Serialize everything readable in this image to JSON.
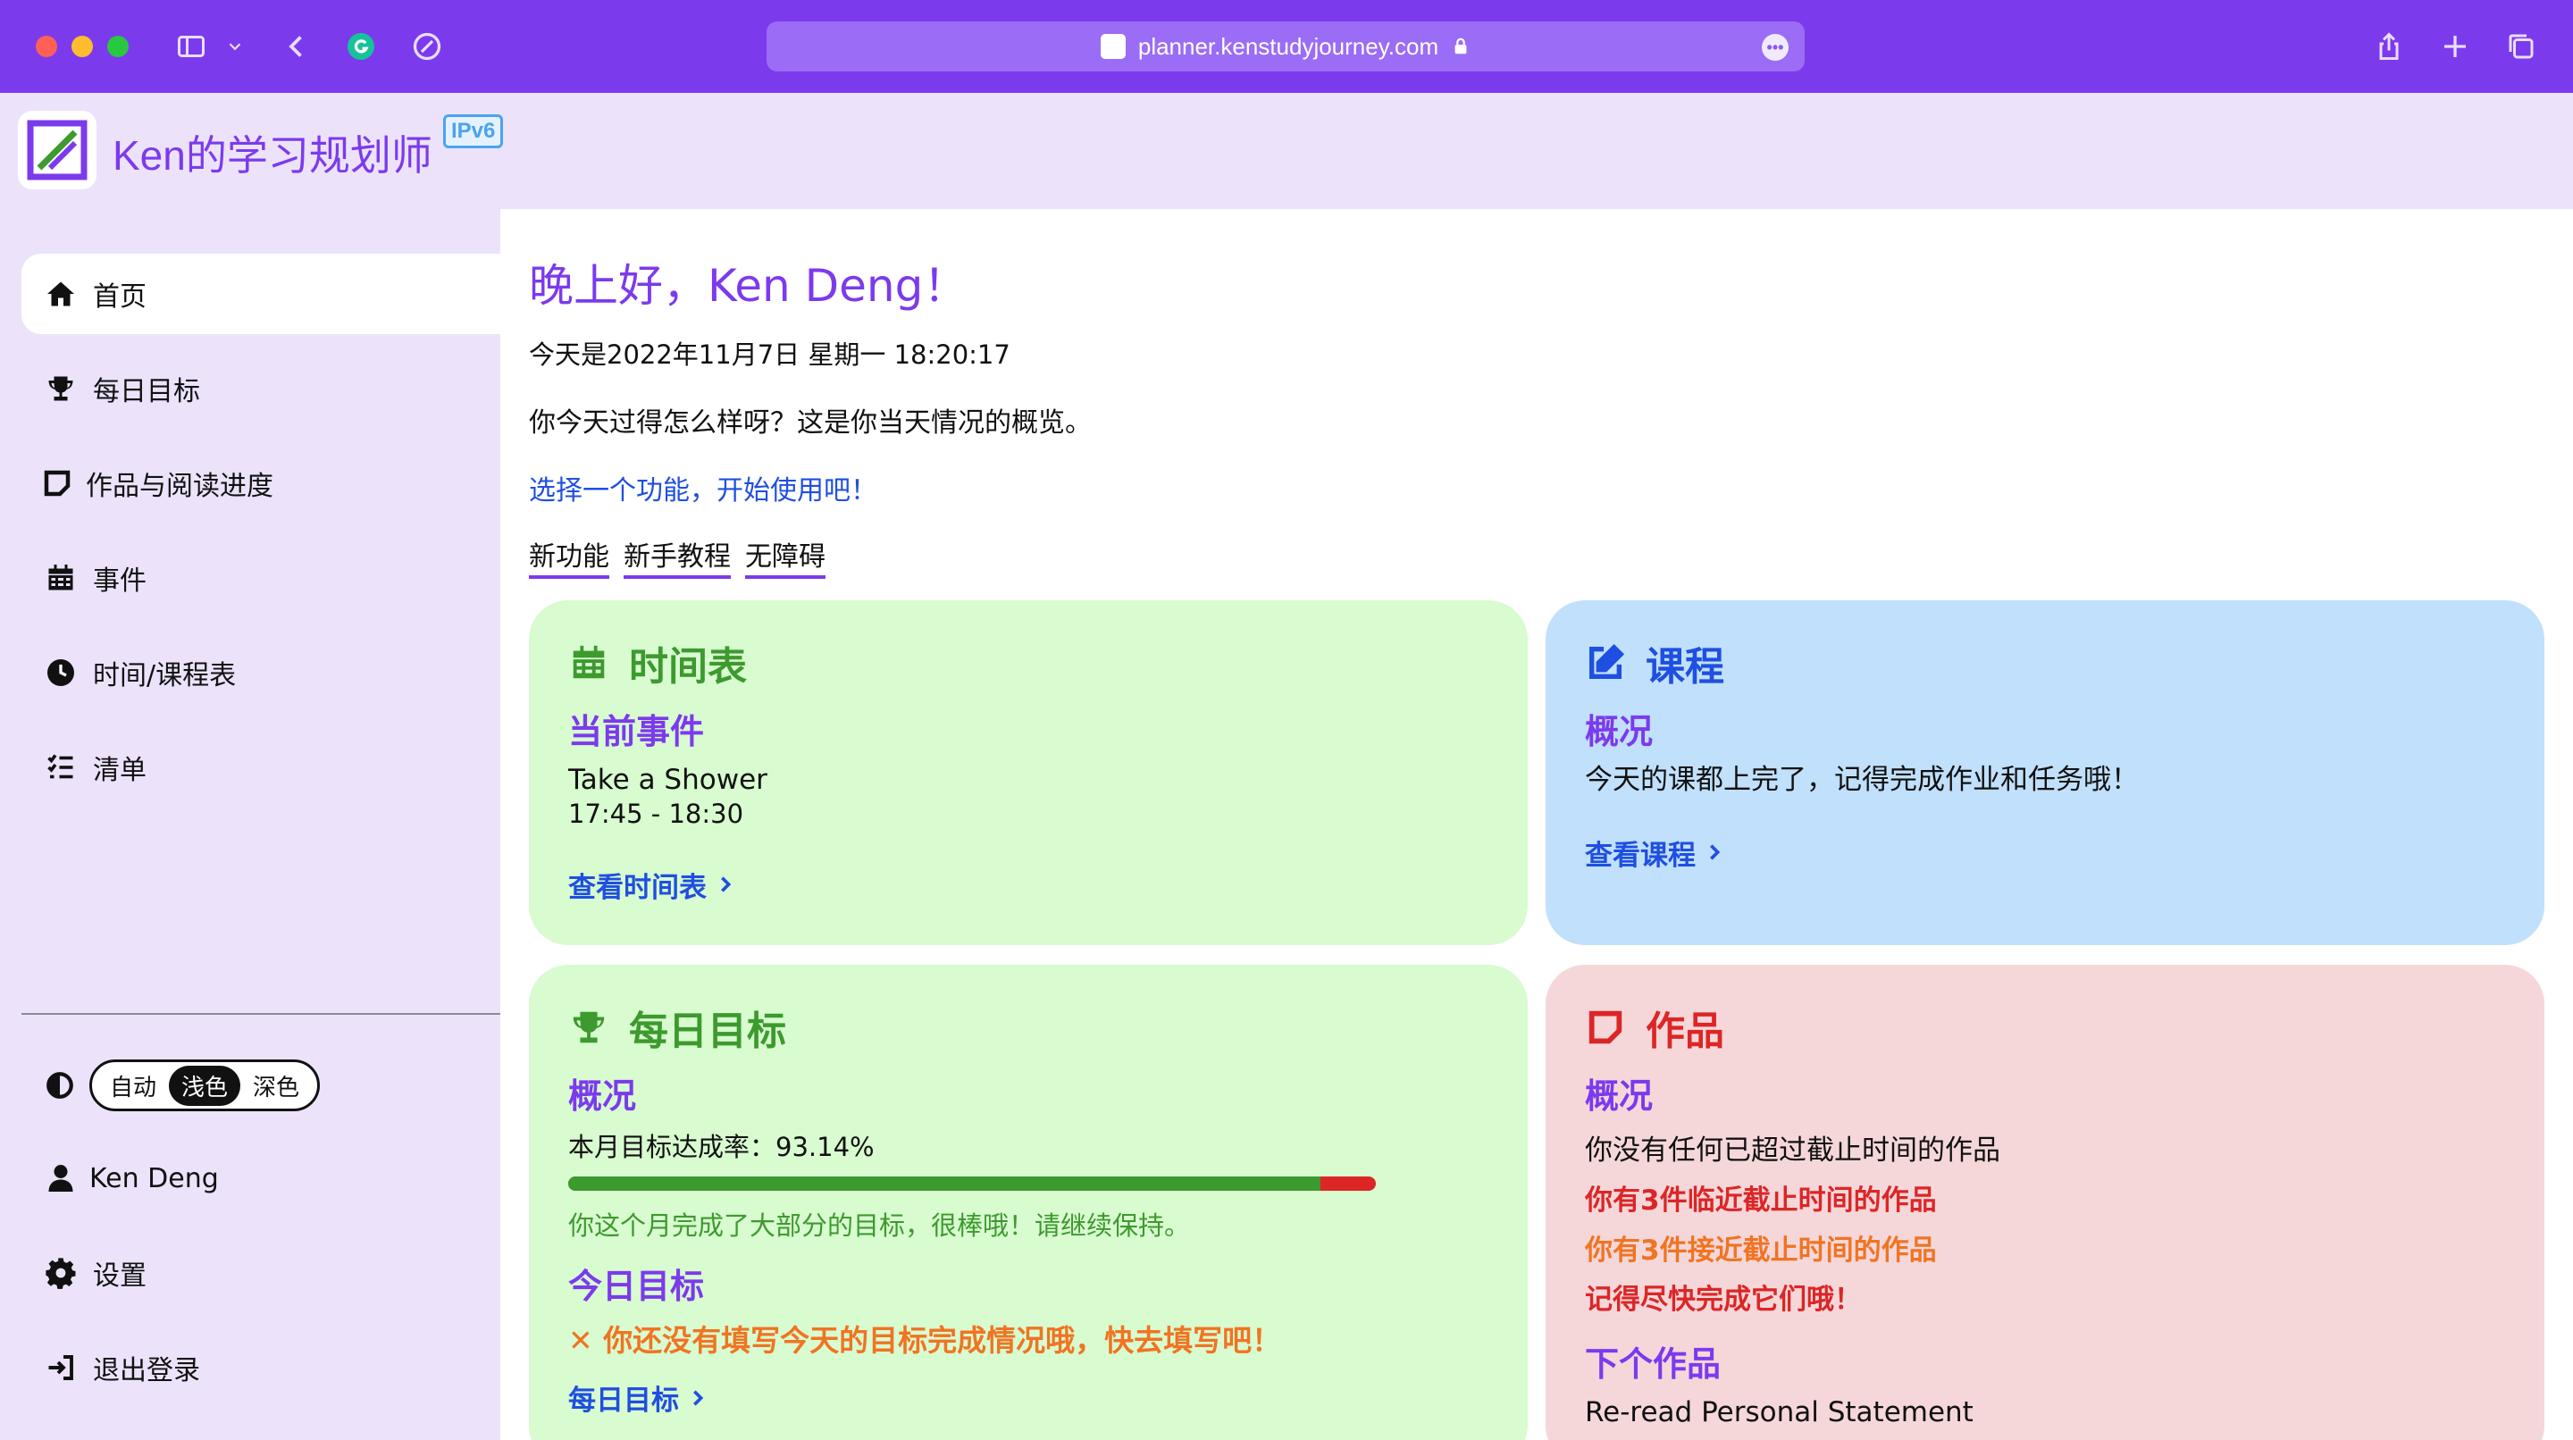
{
  "browser": {
    "url": "planner.kenstudyjourney.com",
    "icons": [
      "sidebar-toggle-icon",
      "chevron-down-icon",
      "back-icon",
      "grammarly-icon",
      "extension-icon",
      "share-icon",
      "new-tab-icon",
      "tab-overview-icon"
    ],
    "colors": {
      "chrome": "#7c3aed",
      "address_bar": "#9b6cf5"
    }
  },
  "app": {
    "name": "Ken的学习规划师",
    "badge": "IPv6",
    "accent": "#7c3aed"
  },
  "sidebar": {
    "items": [
      {
        "label": "首页",
        "icon": "home-icon",
        "active": true
      },
      {
        "label": "每日目标",
        "icon": "trophy-icon",
        "active": false
      },
      {
        "label": "作品与阅读进度",
        "icon": "sticky-note-icon",
        "active": false
      },
      {
        "label": "事件",
        "icon": "calendar-icon",
        "active": false
      },
      {
        "label": "时间/课程表",
        "icon": "clock-icon",
        "active": false
      },
      {
        "label": "清单",
        "icon": "checklist-icon",
        "active": false
      }
    ],
    "theme": {
      "options": [
        "自动",
        "浅色",
        "深色"
      ],
      "selected": "浅色"
    },
    "user": "Ken Deng",
    "settings": "设置",
    "logout": "退出登录"
  },
  "main": {
    "greeting": "晚上好，Ken Deng！",
    "date_line": "今天是2022年11月7日  星期一  18:20:17",
    "question": "你今天过得怎么样呀？这是你当天情况的概览。",
    "prompt": "选择一个功能，开始使用吧！",
    "links": [
      "新功能",
      "新手教程",
      "无障碍"
    ],
    "cards": {
      "schedule": {
        "title": "时间表",
        "subtitle": "当前事件",
        "event": "Take a Shower",
        "time": "17:45 - 18:30",
        "link": "查看时间表"
      },
      "courses": {
        "title": "课程",
        "subtitle": "概况",
        "text": "今天的课都上完了，记得完成作业和任务哦！",
        "link": "查看课程"
      },
      "goals": {
        "title": "每日目标",
        "subtitle": "概况",
        "rate_label": "本月目标达成率：93.14%",
        "rate_value": 93.14,
        "message": "你这个月完成了大部分的目标，很棒哦！请继续保持。",
        "today_title": "今日目标",
        "today_warning": "✕ 你还没有填写今天的目标完成情况哦，快去填写吧！",
        "link": "每日目标"
      },
      "works": {
        "title": "作品",
        "subtitle": "概况",
        "overdue": "你没有任何已超过截止时间的作品",
        "near_due": "你有3件临近截止时间的作品",
        "approaching": "你有3件接近截止时间的作品",
        "reminder": "记得尽快完成它们哦！",
        "next_title": "下个作品",
        "next_item": "Re-read Personal Statement"
      }
    }
  }
}
